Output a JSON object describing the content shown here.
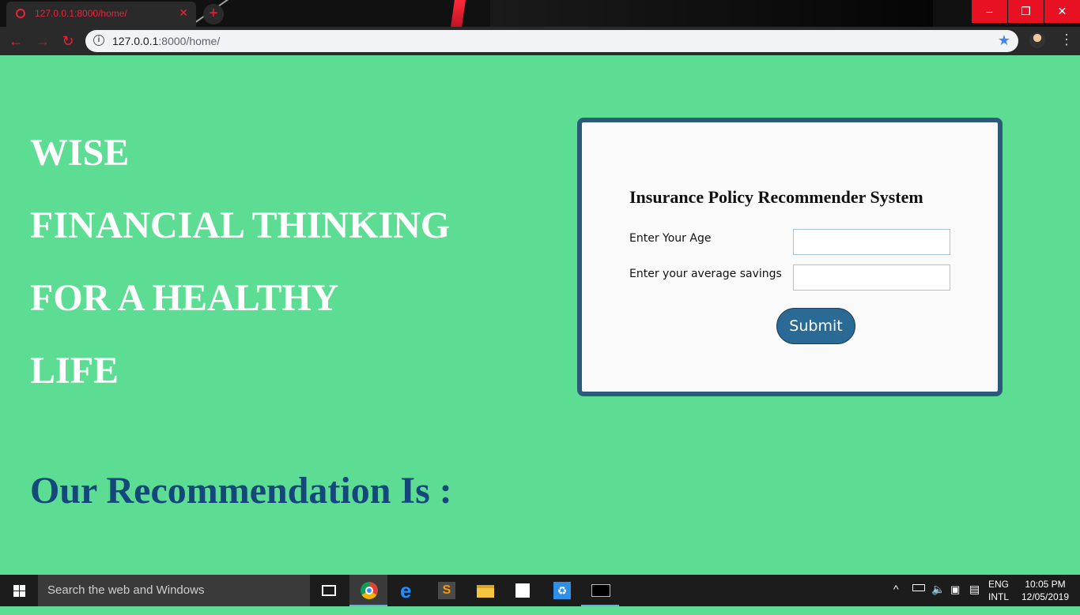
{
  "browser": {
    "tab_title": "127.0.0.1:8000/home/",
    "tab_close": "✕",
    "new_tab": "+",
    "url_host": "127.0.0.1",
    "url_rest": ":8000/home/",
    "window_buttons": {
      "minimize": "–",
      "maximize": "❐",
      "close": "✕"
    },
    "nav": {
      "back": "←",
      "forward": "→",
      "reload": "↻"
    },
    "accent_color": "#e8243b"
  },
  "hero": {
    "lines": [
      "WISE",
      "FINANCIAL THINKING",
      "FOR A HEALTHY",
      "LIFE"
    ],
    "color": "#ffffff"
  },
  "form": {
    "title": "Insurance Policy Recommender System",
    "age_label": "Enter Your Age",
    "age_value": "",
    "savings_label": "Enter your average savings",
    "savings_value": "",
    "submit_label": "Submit",
    "button_color": "#2b6a94"
  },
  "recommendation": {
    "heading": "Our Recommendation Is :",
    "color": "#14477a"
  },
  "page": {
    "background": "#5ddd93"
  },
  "taskbar": {
    "search_placeholder": "Search the web and Windows",
    "apps": [
      "task-view-icon",
      "chrome-icon",
      "edge-icon",
      "sublime-text-icon",
      "file-explorer-icon",
      "store-icon",
      "recycle-app-icon",
      "command-prompt-icon"
    ],
    "lang_line1": "ENG",
    "lang_line2": "INTL",
    "time": "10:05 PM",
    "date": "12/05/2019"
  }
}
